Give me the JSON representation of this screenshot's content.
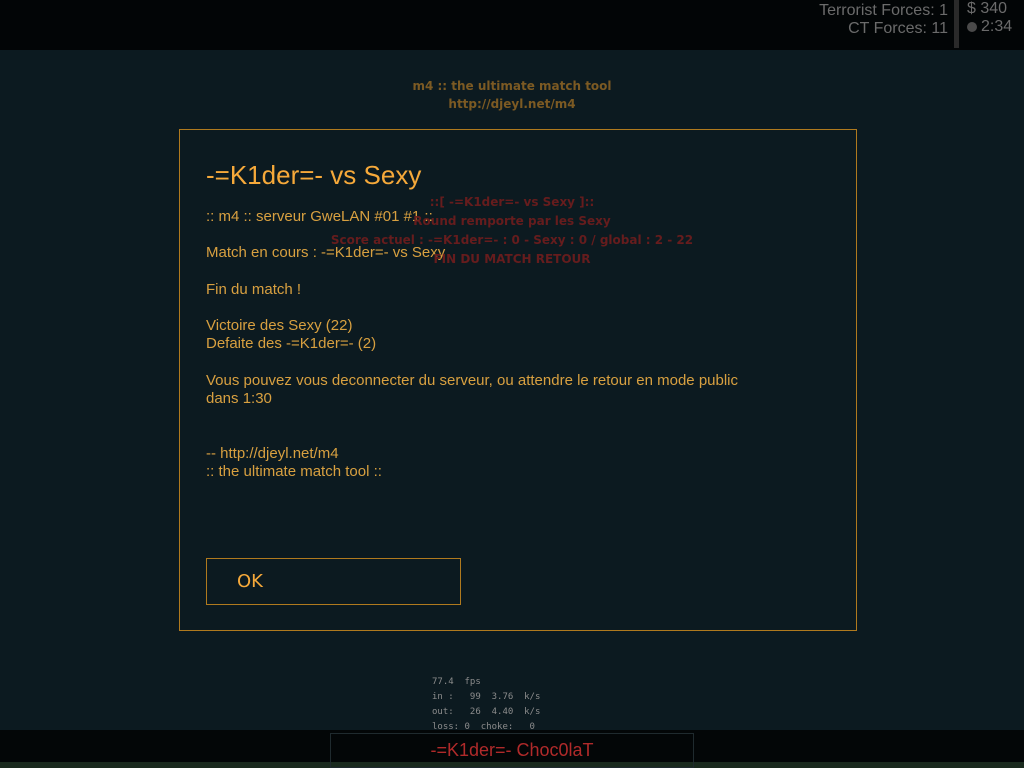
{
  "hud": {
    "terrorist_forces": "Terrorist Forces: 1",
    "ct_forces": "CT Forces: 11",
    "money": "$ 340",
    "timer": "2:34"
  },
  "header": {
    "line1": "m4 :: the ultimate match tool",
    "line2": "http://djeyl.net/m4"
  },
  "dialog": {
    "title": "-=K1der=- vs Sexy",
    "body": ":: m4 :: serveur GweLAN #01 #1 ::\n\nMatch en cours : -=K1der=- vs Sexy\n\nFin du match !\n\nVictoire des Sexy (22)\nDefaite des -=K1der=- (2)\n\nVous pouvez vous deconnecter du serveur, ou attendre le retour en mode public\ndans 1:30\n\n\n-- http://djeyl.net/m4\n:: the ultimate match tool ::",
    "ok_label": "OK"
  },
  "center_message": {
    "line1": "::[ -=K1der=- vs Sexy ]::",
    "line2": "Round remporte par les Sexy",
    "line3": "Score actuel : -=K1der=- : 0 - Sexy : 0 / global : 2 - 22",
    "line4": "FIN DU MATCH RETOUR"
  },
  "netgraph": {
    "fps": "77.4  fps",
    "in": "in :   99  3.76  k/s",
    "out": "out:   26  4.40  k/s",
    "loss": "loss: 0  choke:   0"
  },
  "spectator": {
    "player_name": "-=K1der=- Choc0laT"
  }
}
